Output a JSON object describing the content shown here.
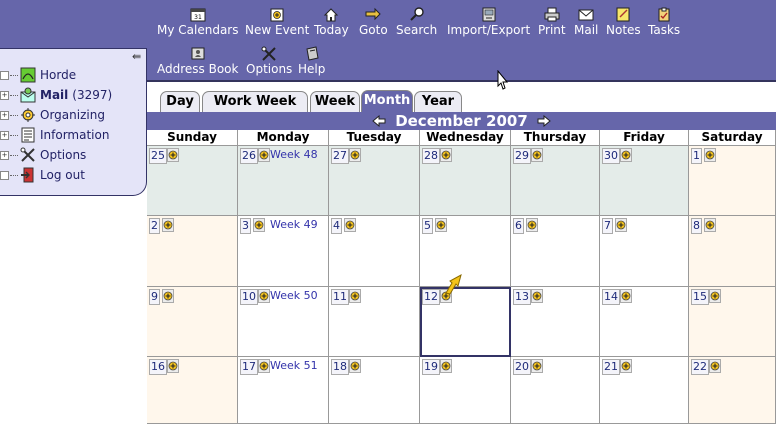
{
  "toolbar": {
    "row1": [
      {
        "key": "calendars",
        "label": "My Calendars",
        "icon": "calendar-icon"
      },
      {
        "key": "new_event",
        "label": "New Event",
        "icon": "new-event-icon"
      },
      {
        "key": "today",
        "label": "Today",
        "icon": "today-icon"
      },
      {
        "key": "goto",
        "label": "Goto",
        "icon": "goto-icon"
      },
      {
        "key": "search",
        "label": "Search",
        "icon": "search-icon"
      },
      {
        "key": "import_export",
        "label": "Import/Export",
        "icon": "import-export-icon"
      },
      {
        "key": "print",
        "label": "Print",
        "icon": "print-icon"
      },
      {
        "key": "mail",
        "label": "Mail",
        "icon": "mail-icon"
      },
      {
        "key": "notes",
        "label": "Notes",
        "icon": "notes-icon"
      },
      {
        "key": "tasks",
        "label": "Tasks",
        "icon": "tasks-icon"
      }
    ],
    "row2": [
      {
        "key": "address_book",
        "label": "Address Book",
        "icon": "address-book-icon"
      },
      {
        "key": "options",
        "label": "Options",
        "icon": "options-icon"
      },
      {
        "key": "help",
        "label": "Help",
        "icon": "help-icon"
      }
    ]
  },
  "sidebar": {
    "items": [
      {
        "label": "Horde",
        "count": "",
        "icon": "horde-icon"
      },
      {
        "label": "Mail",
        "count": "(3297)",
        "icon": "mail-folder-icon"
      },
      {
        "label": "Organizing",
        "count": "",
        "icon": "organizing-icon"
      },
      {
        "label": "Information",
        "count": "",
        "icon": "information-icon"
      },
      {
        "label": "Options",
        "count": "",
        "icon": "options-tools-icon"
      },
      {
        "label": "Log out",
        "count": "",
        "icon": "logout-icon"
      }
    ]
  },
  "tabs": [
    "Day",
    "Work Week",
    "Week",
    "Month",
    "Year"
  ],
  "active_tab": "Month",
  "calendar": {
    "title": "December 2007",
    "weekdays": [
      "Sunday",
      "Monday",
      "Tuesday",
      "Wednesday",
      "Thursday",
      "Friday",
      "Saturday"
    ],
    "weeks": [
      {
        "label": "Week 48",
        "days": [
          "25",
          "26",
          "27",
          "28",
          "29",
          "30",
          "1"
        ]
      },
      {
        "label": "Week 49",
        "days": [
          "2",
          "3",
          "4",
          "5",
          "6",
          "7",
          "8"
        ]
      },
      {
        "label": "Week 50",
        "days": [
          "9",
          "10",
          "11",
          "12",
          "13",
          "14",
          "15"
        ]
      },
      {
        "label": "Week 51",
        "days": [
          "16",
          "17",
          "18",
          "19",
          "20",
          "21",
          "22"
        ]
      }
    ],
    "today": "12"
  },
  "colors": {
    "header": "#6666aa",
    "weekend": "#fff7ec",
    "other_month": "#e4ece9"
  }
}
